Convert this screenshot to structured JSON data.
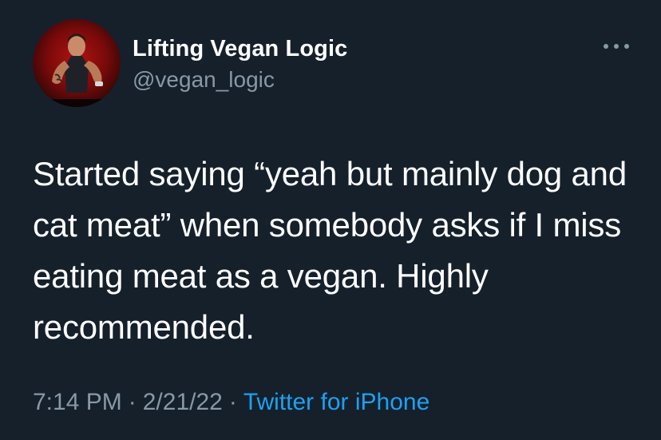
{
  "tweet": {
    "author": {
      "display_name": "Lifting Vegan Logic",
      "handle": "@vegan_logic",
      "avatar_icon": "profile-photo"
    },
    "more_icon": "ellipsis-icon",
    "text": "Started saying “yeah but mainly dog and cat meat” when somebody asks if I miss eating meat as a vegan. Highly recommended.",
    "time": "7:14 PM",
    "date": "2/21/22",
    "separator": "·",
    "source": "Twitter for iPhone"
  },
  "colors": {
    "background": "#15202b",
    "primary_text": "#ffffff",
    "secondary_text": "#8899a6",
    "link": "#1da1f2"
  }
}
